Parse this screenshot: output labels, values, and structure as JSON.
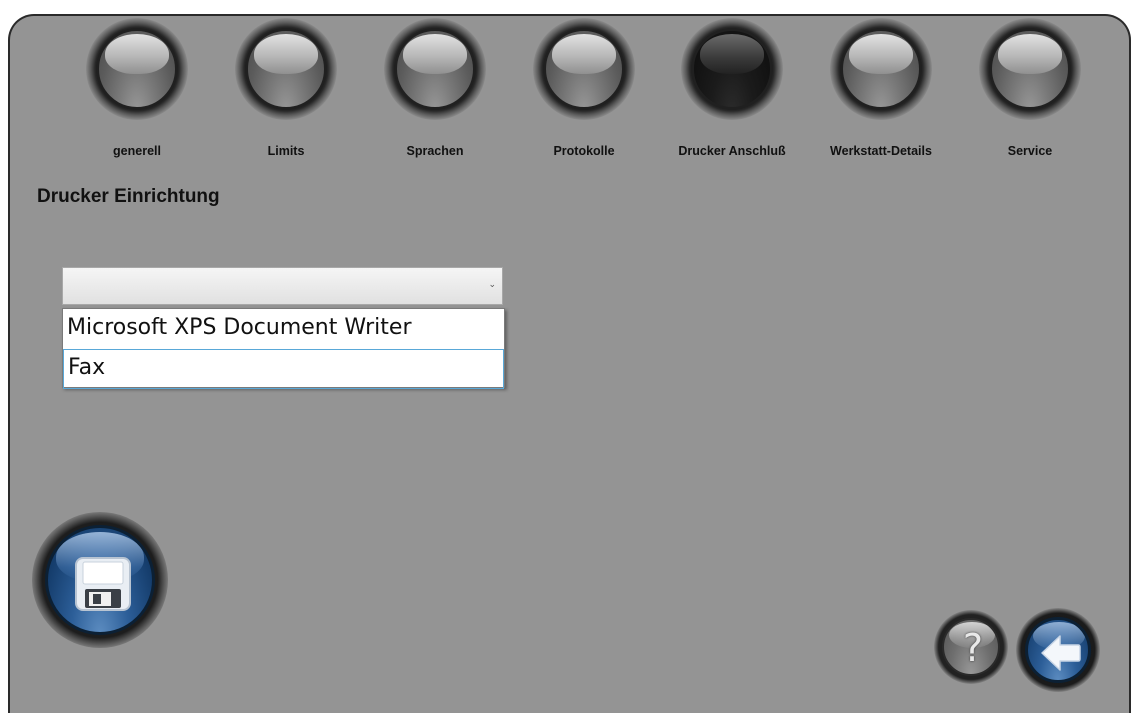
{
  "nav": {
    "tabs": [
      {
        "label": "generell",
        "active": false
      },
      {
        "label": "Limits",
        "active": false
      },
      {
        "label": "Sprachen",
        "active": false
      },
      {
        "label": "Protokolle",
        "active": false
      },
      {
        "label": "Drucker Anschluß",
        "active": true
      },
      {
        "label": "Werkstatt-Details",
        "active": false
      },
      {
        "label": "Service",
        "active": false
      }
    ]
  },
  "section": {
    "title": "Drucker Einrichtung"
  },
  "printer_select": {
    "value": "",
    "expanded": true,
    "options": [
      {
        "label": "Microsoft XPS Document Writer"
      },
      {
        "label": "Fax"
      }
    ]
  },
  "buttons": {
    "help_symbol": "?",
    "save_icon": "floppy-disk-icon",
    "back_icon": "arrow-left-icon",
    "help_icon": "question-mark-icon"
  },
  "colors": {
    "panel": "#949494",
    "orb_inactive": "#b8b8b8",
    "orb_active": "#1b1b1b",
    "accent_blue": "#2c5e98"
  }
}
